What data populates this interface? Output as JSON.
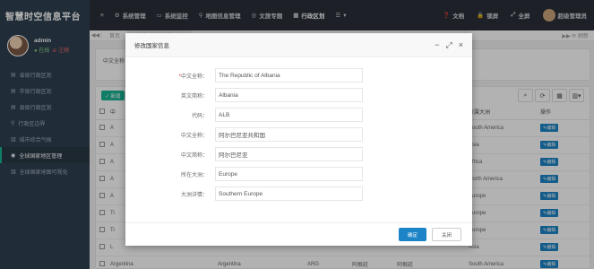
{
  "brand": "智慧时空信息平台",
  "topnav": [
    {
      "icon": "menu-icon",
      "label": "≡"
    },
    {
      "icon": "gear-icon",
      "label": "系统管理"
    },
    {
      "icon": "monitor-icon",
      "label": "系统监控"
    },
    {
      "icon": "pin-icon",
      "label": "地图信息管理"
    },
    {
      "icon": "target-icon",
      "label": "文旅专题"
    },
    {
      "icon": "grid-icon",
      "label": "行政区划"
    },
    {
      "icon": "list-icon",
      "label": "▾"
    }
  ],
  "topright": [
    {
      "icon": "question-icon",
      "label": "文档"
    },
    {
      "icon": "lock-icon",
      "label": "锁屏"
    },
    {
      "icon": "fullscreen-icon",
      "label": "全屏"
    },
    {
      "icon": "user-icon",
      "label": "超级管理员"
    }
  ],
  "profile": {
    "name": "admin",
    "status": "● 在线",
    "logout": "⊖ 注销"
  },
  "menu": [
    {
      "icon": "map-icon",
      "label": "省级行政区划"
    },
    {
      "icon": "map-icon",
      "label": "市级行政区划"
    },
    {
      "icon": "map-icon",
      "label": "县级行政区划"
    },
    {
      "icon": "location-icon",
      "label": "行政区边界"
    },
    {
      "icon": "chart-icon",
      "label": "城市综合气候"
    },
    {
      "icon": "globe-icon",
      "label": "全球国家地区管理",
      "active": true
    },
    {
      "icon": "chart-icon",
      "label": "全球国家地图可视化"
    }
  ],
  "tabs": {
    "back": "◀◀",
    "home": "首页",
    "current": "全球国家地区管理 ×",
    "right": "▶▶  ⟳ 刷新"
  },
  "search_panel_text": "中文全称：",
  "add_label": "✓ 新增",
  "tool_icons": [
    "⌕",
    "⟳",
    "▦",
    "▥▾"
  ],
  "table": {
    "headers": [
      "",
      "中",
      "",
      "",
      "",
      "",
      "所属大洲",
      "操作"
    ],
    "rows": [
      {
        "c1": "A",
        "cont": "South America"
      },
      {
        "c1": "A",
        "cont": "Asia"
      },
      {
        "c1": "A",
        "cont": "Africa"
      },
      {
        "c1": "A",
        "cont": "North America"
      },
      {
        "c1": "A",
        "cont": "Europe"
      },
      {
        "c1": "Ti",
        "cont": "Europe"
      },
      {
        "c1": "Ti",
        "cont": "Europe"
      },
      {
        "c1": "L",
        "cont": "Asia"
      },
      {
        "c1": "Argentina",
        "c2": "Argentina",
        "c3": "ARG",
        "c4": "阿根廷",
        "c5": "阿根廷",
        "cont": "South America"
      }
    ],
    "edit_label": "✎编辑"
  },
  "modal": {
    "title": "修改国家信息",
    "controls": {
      "min": "−",
      "max": "⤢",
      "close": "×"
    },
    "fields": [
      {
        "label": "中文全称：",
        "required": true,
        "value": "The Republic of Albania"
      },
      {
        "label": "英文简称：",
        "required": false,
        "value": "Albania"
      },
      {
        "label": "代码：",
        "required": false,
        "value": "ALB"
      },
      {
        "label": "中文全称：",
        "required": false,
        "value": "阿尔巴尼亚共和国"
      },
      {
        "label": "中文简称：",
        "required": false,
        "value": "阿尔巴尼亚"
      },
      {
        "label": "所在大洲：",
        "required": false,
        "value": "Europe"
      },
      {
        "label": "大洲详情：",
        "required": false,
        "value": "Southern Europe"
      }
    ],
    "confirm": "确定",
    "close": "关闭"
  }
}
